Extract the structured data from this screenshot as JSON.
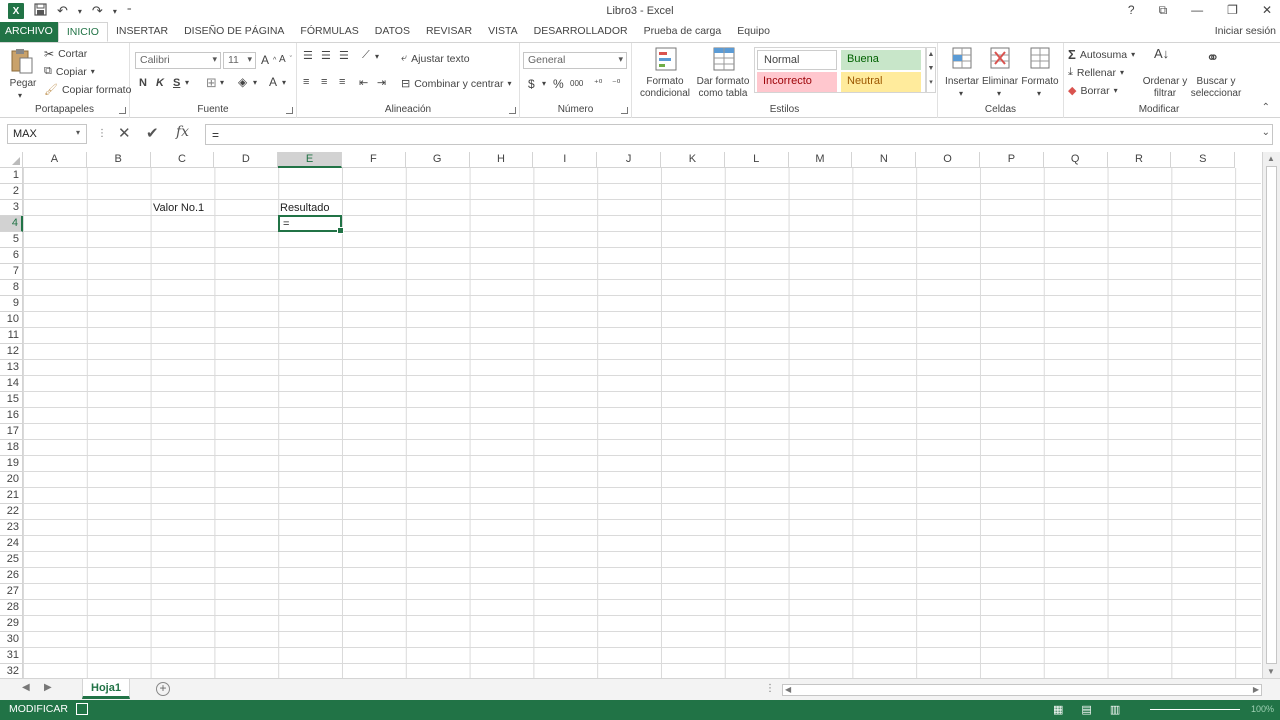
{
  "window": {
    "title": "Libro3 - Excel",
    "app_icon": "X",
    "controls": [
      "?",
      "⧉",
      "—",
      "❐",
      "✕"
    ],
    "signin": "Iniciar sesión"
  },
  "tabs": [
    "ARCHIVO",
    "INICIO",
    "INSERTAR",
    "DISEÑO DE PÁGINA",
    "FÓRMULAS",
    "DATOS",
    "REVISAR",
    "VISTA",
    "DESARROLLADOR",
    "Prueba de carga",
    "Equipo"
  ],
  "ribbon": {
    "portapapeles": {
      "label": "Portapapeles",
      "pegar": "Pegar",
      "cortar": "Cortar",
      "copiar": "Copiar",
      "copiar_formato": "Copiar formato"
    },
    "fuente": {
      "label": "Fuente",
      "font_name": "Calibri",
      "font_size": "11",
      "bold": "N",
      "italic": "K",
      "underline": "S"
    },
    "alineacion": {
      "label": "Alineación",
      "ajustar": "Ajustar texto",
      "combinar": "Combinar y centrar"
    },
    "numero": {
      "label": "Número",
      "format": "General",
      "currency": "$",
      "percent": "%",
      "thousands": "000"
    },
    "estilos": {
      "label": "Estilos",
      "formato_condicional_1": "Formato",
      "formato_condicional_2": "condicional",
      "dar_formato_1": "Dar formato",
      "dar_formato_2": "como tabla",
      "normal": "Normal",
      "buena": "Buena",
      "incorrecto": "Incorrecto",
      "neutral": "Neutral"
    },
    "celdas": {
      "label": "Celdas",
      "insertar": "Insertar",
      "eliminar": "Eliminar",
      "formato": "Formato"
    },
    "modificar": {
      "label": "Modificar",
      "autosuma": "Autosuma",
      "rellenar": "Rellenar",
      "borrar": "Borrar",
      "ordenar_1": "Ordenar y",
      "ordenar_2": "filtrar",
      "buscar_1": "Buscar y",
      "buscar_2": "seleccionar"
    }
  },
  "formula_bar": {
    "name_box": "MAX",
    "content": "="
  },
  "columns": [
    "A",
    "B",
    "C",
    "D",
    "E",
    "F",
    "G",
    "H",
    "I",
    "J",
    "K",
    "L",
    "M",
    "N",
    "O",
    "P",
    "Q",
    "R",
    "S"
  ],
  "rows": [
    "1",
    "2",
    "3",
    "4",
    "5",
    "6",
    "7",
    "8",
    "9",
    "10",
    "11",
    "12",
    "13",
    "14",
    "15",
    "16",
    "17",
    "18",
    "19",
    "20",
    "21",
    "22",
    "23",
    "24",
    "25",
    "26",
    "27",
    "28",
    "29",
    "30",
    "31",
    "32"
  ],
  "cells": {
    "C3": "Valor No.1",
    "E3": "Resultado",
    "E4": "="
  },
  "selected": {
    "column": "E",
    "row": "4"
  },
  "sheets": {
    "active": "Hoja1",
    "add": "+"
  },
  "status": {
    "mode": "MODIFICAR",
    "zoom": "100%"
  },
  "colors": {
    "accent": "#217346",
    "style_normal_bg": "#ffffff",
    "style_buena_bg": "#c6efce",
    "style_incorrecto_bg": "#ffc7ce",
    "style_neutral_bg": "#ffeb9c"
  }
}
